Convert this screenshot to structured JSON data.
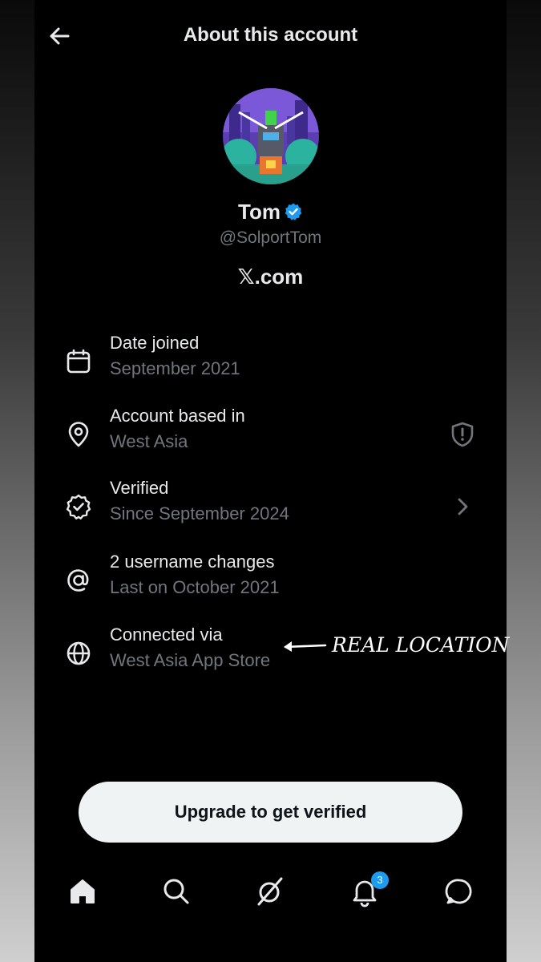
{
  "header": {
    "title": "About this account"
  },
  "profile": {
    "name": "Tom",
    "handle": "@SolportTom",
    "platform": "𝕏.com",
    "verified_badge_color": "#1d9bf0"
  },
  "details": [
    {
      "icon": "calendar-icon",
      "title": "Date joined",
      "subtitle": "September 2021"
    },
    {
      "icon": "location-pin-icon",
      "title": "Account based in",
      "subtitle": "West Asia",
      "right_icon": "shield-alert-icon"
    },
    {
      "icon": "verified-check-icon",
      "title": "Verified",
      "subtitle": "Since September 2024",
      "right_icon": "chevron-right-icon"
    },
    {
      "icon": "at-sign-icon",
      "title": "2 username changes",
      "subtitle": "Last on October 2021"
    },
    {
      "icon": "globe-icon",
      "title": "Connected via",
      "subtitle": "West Asia App Store"
    }
  ],
  "annotation": {
    "text": "REAL LOCATION"
  },
  "cta": {
    "label": "Upgrade to get verified"
  },
  "bottom_nav": {
    "items": [
      "home-icon",
      "search-icon",
      "grok-icon",
      "bell-icon",
      "messages-icon"
    ],
    "notification_count": "3"
  },
  "colors": {
    "background": "#000000",
    "primary_text": "#e7e9ea",
    "secondary_text": "#71767b",
    "accent": "#1d9bf0",
    "button_bg": "#eff3f4"
  }
}
